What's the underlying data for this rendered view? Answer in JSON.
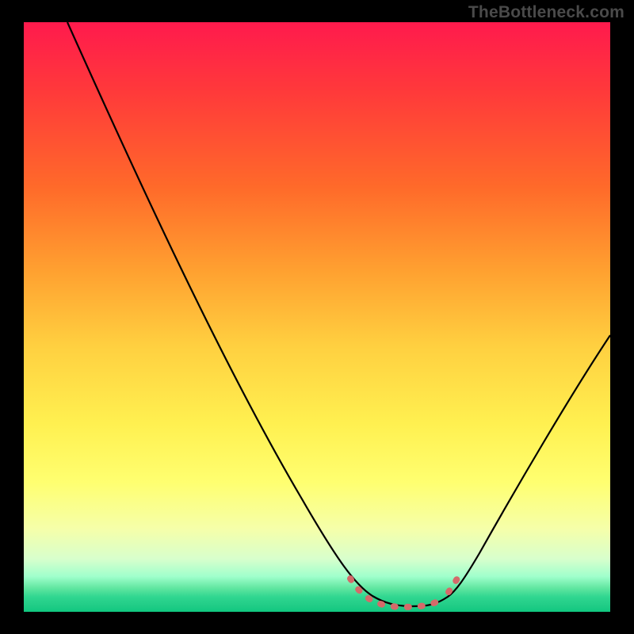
{
  "watermark": "TheBottleneck.com",
  "chart_data": {
    "type": "line",
    "title": "",
    "xlabel": "",
    "ylabel": "",
    "xlim": [
      0,
      100
    ],
    "ylim": [
      0,
      100
    ],
    "x": [
      0,
      5,
      10,
      15,
      20,
      25,
      30,
      35,
      40,
      45,
      50,
      55,
      58,
      60,
      62,
      64,
      66,
      68,
      70,
      72,
      75,
      80,
      85,
      90,
      95,
      100
    ],
    "values": [
      100,
      92,
      84,
      76,
      68,
      60,
      52,
      44,
      36,
      28,
      20,
      12,
      7,
      4,
      2,
      1,
      1,
      1,
      1,
      2,
      4,
      10,
      18,
      27,
      37,
      48
    ],
    "annotation": {
      "type": "dashed_segment",
      "x": [
        56,
        58,
        60,
        62,
        64,
        66,
        68,
        70,
        72,
        73
      ],
      "values": [
        5,
        3.5,
        2.2,
        1.4,
        1,
        1,
        1,
        1.4,
        2.2,
        3
      ],
      "color": "#d46a6a"
    }
  }
}
